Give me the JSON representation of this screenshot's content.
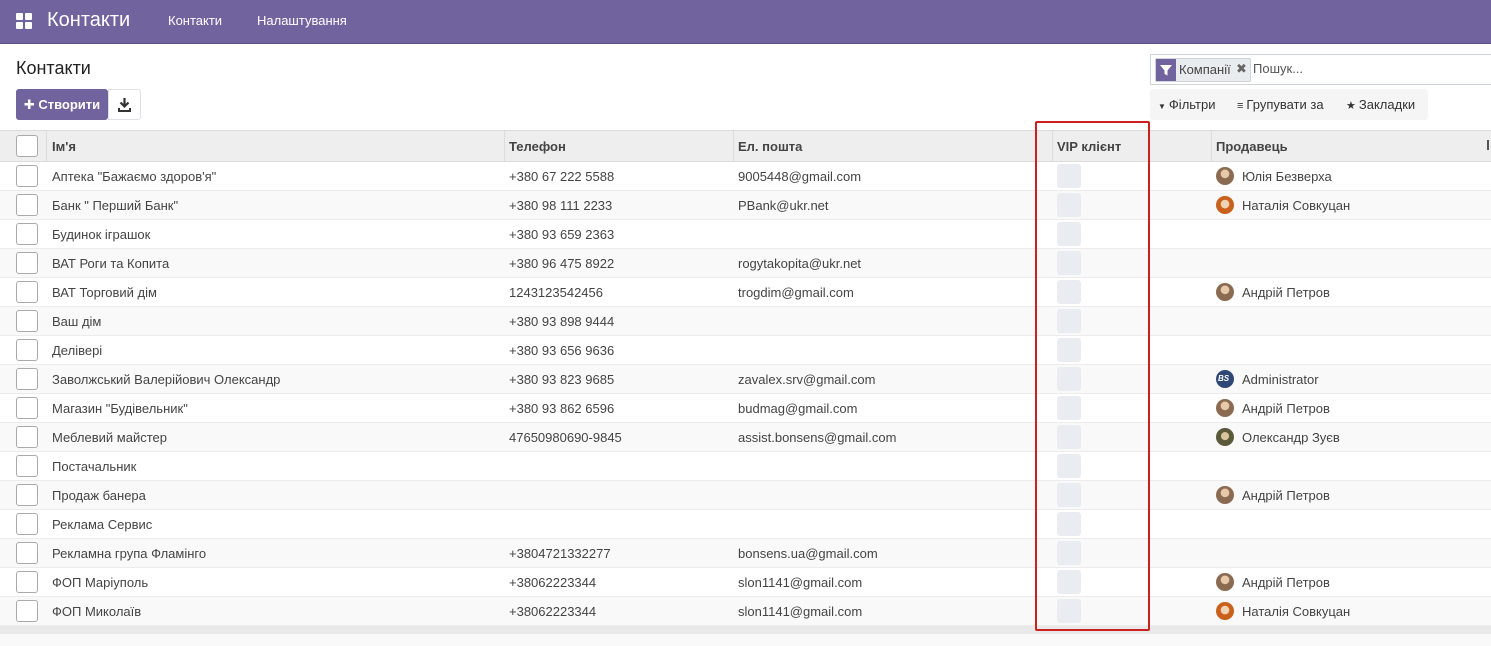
{
  "navbar": {
    "app_title": "Контакти",
    "menu": [
      "Контакти",
      "Налаштування"
    ]
  },
  "control_panel": {
    "title": "Контакти",
    "create_label": "✚ Створити"
  },
  "search": {
    "facet_label": "Компанії",
    "placeholder": "Пошук...",
    "options": [
      {
        "glyph": "▼",
        "label": "Фільтри"
      },
      {
        "glyph": "≡",
        "label": "Групувати за"
      },
      {
        "glyph": "★",
        "label": "Закладки"
      }
    ]
  },
  "table": {
    "columns": [
      "Ім'я",
      "Телефон",
      "Ел. пошта",
      "VIP клієнт",
      "Продавець"
    ],
    "rows": [
      {
        "name": "Аптека \"Бажаємо здоров'я\"",
        "phone": "+380 67 222 5588",
        "email": "9005448@gmail.com",
        "seller": "Юлія Безверха",
        "avatar": "brown"
      },
      {
        "name": "Банк \" Перший Банк\"",
        "phone": "+380 98 111 2233",
        "email": "PBank@ukr.net",
        "seller": "Наталія Совкуцан",
        "avatar": "orange"
      },
      {
        "name": "Будинок іграшок",
        "phone": "+380 93 659 2363",
        "email": "",
        "seller": "",
        "avatar": ""
      },
      {
        "name": "ВАТ Роги та Копита",
        "phone": "+380 96 475 8922",
        "email": "rogytakopita@ukr.net",
        "seller": "",
        "avatar": ""
      },
      {
        "name": "ВАТ Торговий дім",
        "phone": "1243123542456",
        "email": "trogdim@gmail.com",
        "seller": "Андрій Петров",
        "avatar": "brown"
      },
      {
        "name": "Ваш дім",
        "phone": "+380 93 898 9444",
        "email": "",
        "seller": "",
        "avatar": ""
      },
      {
        "name": "Делівері",
        "phone": "+380 93 656 9636",
        "email": "",
        "seller": "",
        "avatar": ""
      },
      {
        "name": "Заволжський Валерійович Олександр",
        "phone": "+380 93 823 9685",
        "email": "zavalex.srv@gmail.com",
        "seller": "Administrator",
        "avatar": "admin"
      },
      {
        "name": "Магазин \"Будівельник\"",
        "phone": "+380 93 862 6596",
        "email": "budmag@gmail.com",
        "seller": "Андрій Петров",
        "avatar": "brown"
      },
      {
        "name": "Меблевий майстер",
        "phone": "47650980690-9845",
        "email": "assist.bonsens@gmail.com",
        "seller": "Олександр Зуєв",
        "avatar": "olive"
      },
      {
        "name": "Постачальник",
        "phone": "",
        "email": "",
        "seller": "",
        "avatar": ""
      },
      {
        "name": "Продаж банера",
        "phone": "",
        "email": "",
        "seller": "Андрій Петров",
        "avatar": "brown"
      },
      {
        "name": "Реклама Сервис",
        "phone": "",
        "email": "",
        "seller": "",
        "avatar": ""
      },
      {
        "name": "Рекламна група Фламінго",
        "phone": "+3804721332277",
        "email": "bonsens.ua@gmail.com",
        "seller": "",
        "avatar": ""
      },
      {
        "name": "ФОП Маріуполь",
        "phone": "+38062223344",
        "email": "slon1141@gmail.com",
        "seller": "Андрій Петров",
        "avatar": "brown"
      },
      {
        "name": "ФОП Миколаїв",
        "phone": "+38062223344",
        "email": "slon1141@gmail.com",
        "seller": "Наталія Совкуцан",
        "avatar": "orange"
      }
    ]
  },
  "colors": {
    "brand": "#71639e",
    "highlight": "#cc1f1f"
  },
  "icons": {
    "apps": "apps-grid-icon",
    "download": "download-icon",
    "facet": "filter-icon",
    "facet_close": "close-icon"
  }
}
